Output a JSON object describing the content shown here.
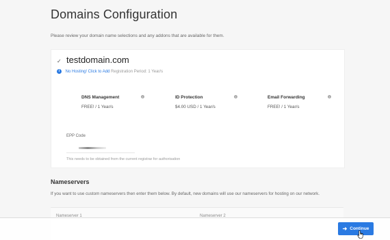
{
  "page": {
    "title": "Domains Configuration",
    "intro": "Please review your domain name selections and any addons that are available for them."
  },
  "domain": {
    "name": "testdomain.com",
    "hosting_link": "No Hosting! Click to Add",
    "registration_period": "Registration Period: 1 Year/s"
  },
  "addons": [
    {
      "name": "DNS Management",
      "price": "FREE! / 1 Year/s"
    },
    {
      "name": "ID Protection",
      "price": "$4.00 USD / 1 Year/s"
    },
    {
      "name": "Email Forwarding",
      "price": "FREE! / 1 Year/s"
    }
  ],
  "epp": {
    "label": "EPP Code",
    "help": "This needs to be obtained from the current registrar for authorisation"
  },
  "nameservers": {
    "title": "Nameservers",
    "description": "If you want to use custom nameservers then enter them below. By default, new domains will use our nameservers for hosting on our network.",
    "ns1_label": "Nameserver 1",
    "ns2_label": "Nameserver 2"
  },
  "actions": {
    "continue_label": "Continue"
  },
  "colors": {
    "accent": "#2a7ae2"
  },
  "icons": {
    "checkmark": "check-icon",
    "info": "info-icon",
    "arrow": "arrow-right-icon",
    "cursor": "hand-cursor-icon"
  }
}
